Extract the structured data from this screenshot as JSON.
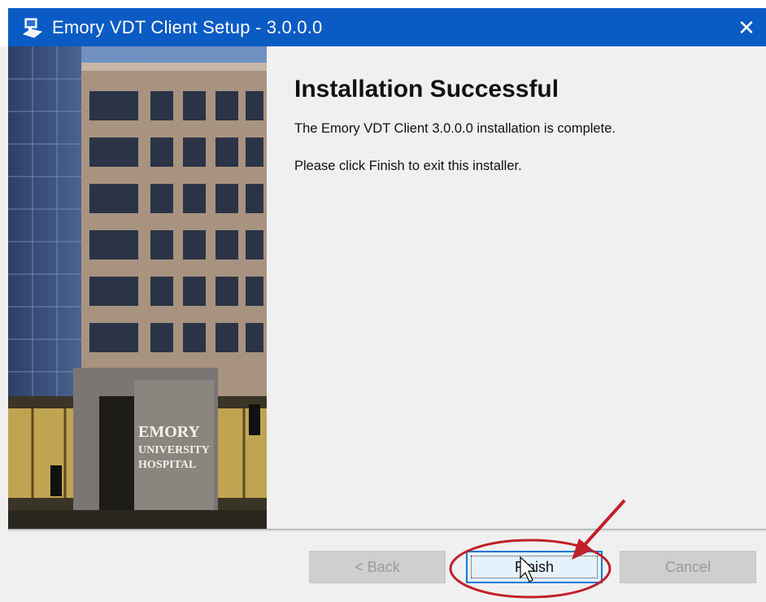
{
  "window": {
    "title": "Emory VDT Client Setup - 3.0.0.0",
    "close_glyph": "✕"
  },
  "banner": {
    "sign_lines": [
      "EMORY",
      "UNIVERSITY",
      "HOSPITAL"
    ]
  },
  "content": {
    "heading": "Installation Successful",
    "message": "The Emory VDT Client 3.0.0.0 installation is complete.",
    "instruction": "Please click Finish to exit this installer."
  },
  "buttons": {
    "back": "< Back",
    "finish": "Finish",
    "cancel": "Cancel"
  },
  "annotation": {
    "color": "#c0202a"
  }
}
